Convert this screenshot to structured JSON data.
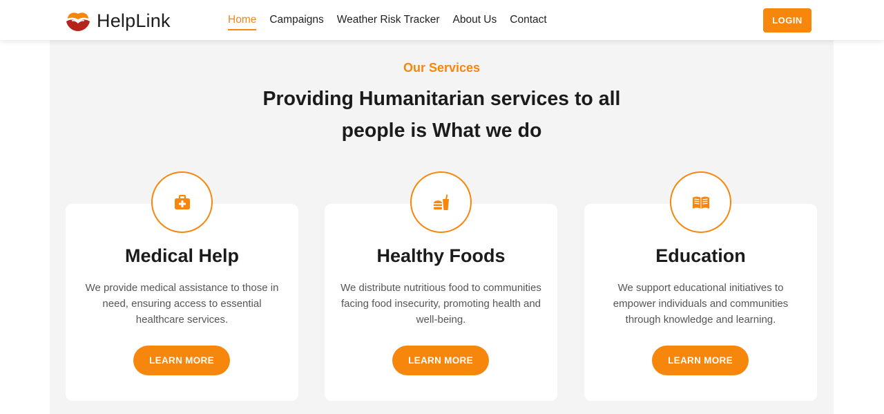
{
  "brand": {
    "name": "HelpLink",
    "logo_icon": "hands-heart-icon"
  },
  "nav": {
    "items": [
      {
        "label": "Home",
        "active": true
      },
      {
        "label": "Campaigns",
        "active": false
      },
      {
        "label": "Weather Risk Tracker",
        "active": false
      },
      {
        "label": "About Us",
        "active": false
      },
      {
        "label": "Contact",
        "active": false
      }
    ],
    "login_label": "LOGIN"
  },
  "colors": {
    "accent": "#f7860c",
    "section_bg": "#f4f4f4",
    "card_bg": "#ffffff"
  },
  "services": {
    "eyebrow": "Our Services",
    "headline": "Providing Humanitarian services to all people is What we do",
    "cards": [
      {
        "icon": "medical-kit-icon",
        "title": "Medical Help",
        "text": "We provide medical assistance to those in need, ensuring access to essential healthcare services.",
        "button": "LEARN MORE"
      },
      {
        "icon": "food-burger-drink-icon",
        "title": "Healthy Foods",
        "text": "We distribute nutritious food to communities facing food insecurity, promoting health and well-being.",
        "button": "LEARN MORE"
      },
      {
        "icon": "open-book-icon",
        "title": "Education",
        "text": "We support educational initiatives to empower individuals and communities through knowledge and learning.",
        "button": "LEARN MORE"
      }
    ]
  }
}
